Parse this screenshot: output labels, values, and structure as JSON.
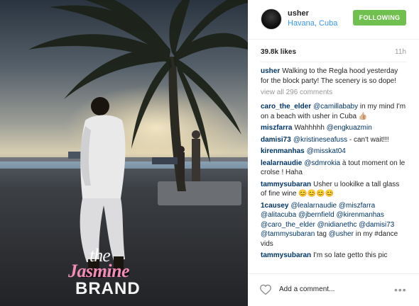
{
  "post": {
    "username": "usher",
    "location": "Havana, Cuba",
    "follow_label": "FOLLOWING",
    "likes": "39.8k likes",
    "time": "11h",
    "caption_user": "usher",
    "caption_text": "Walking to the Regla hood yesterday for the block party! The scenery is so dope!",
    "view_all": "view all 296 comments",
    "add_comment": "Add a comment...",
    "more": "•••"
  },
  "comments": [
    {
      "user": "caro_the_elder",
      "mention": "@camillababy",
      "text": " in my mind I'm on a beach with usher in Cuba 👍🏼"
    },
    {
      "user": "miszfarra",
      "pre": "Wahhhhh ",
      "mention": "@engkuazmin",
      "text": ""
    },
    {
      "user": "damisi73",
      "mention": "@kristineseafuss",
      "text": " - can't wait!!!"
    },
    {
      "user": "kirenmanhas",
      "mention": "@misskat04",
      "text": ""
    },
    {
      "user": "lealarnaudie",
      "mention": "@sdmrokia",
      "text": " à tout moment on le crolse ! Haha"
    },
    {
      "user": "tammysubaran",
      "pre": "Usher u lookilke a tall glass of fine wine ",
      "mention": "",
      "text": "😊😊😊😊"
    },
    {
      "user": "1causey",
      "mention": "@lealarnaudie @miszfarra @alitacuba @jbernfield @kirenmanhas @caro_the_elder @nidianethc @damisi73 @tammysubaran",
      "text": " tag ",
      "mention2": "@usher",
      "text2": " in my #dance vids"
    },
    {
      "user": "tammysubaran",
      "pre": "I'm so late getto this pic",
      "mention": "",
      "text": ""
    }
  ],
  "watermark": {
    "line1": "the",
    "line2": "Jasmine",
    "line3": "BRAND"
  },
  "colors": {
    "follow_green": "#70c050",
    "link_blue": "#3897f0",
    "username_navy": "#003569",
    "watermark_pink": "#f28bb5"
  },
  "icons": {
    "like": "heart-outline-icon",
    "options": "more-dots-icon"
  }
}
